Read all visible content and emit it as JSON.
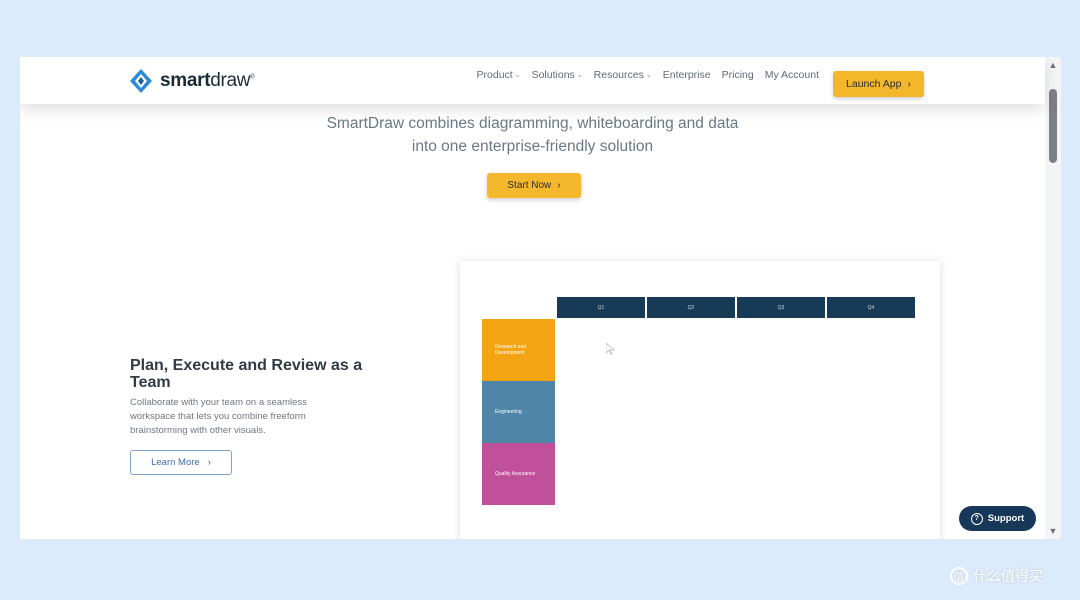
{
  "logo": {
    "name": "smartdraw",
    "part_bold": "smart",
    "part_regular": "draw",
    "mark": "®"
  },
  "nav": {
    "items": [
      {
        "label": "Product",
        "has_dropdown": true
      },
      {
        "label": "Solutions",
        "has_dropdown": true
      },
      {
        "label": "Resources",
        "has_dropdown": true
      },
      {
        "label": "Enterprise",
        "has_dropdown": false
      },
      {
        "label": "Pricing",
        "has_dropdown": false
      },
      {
        "label": "My Account",
        "has_dropdown": false
      }
    ],
    "launch_label": "Launch App"
  },
  "hero": {
    "tagline_line1": "SmartDraw combines diagramming, whiteboarding and data",
    "tagline_line2": "into one enterprise-friendly solution",
    "start_label": "Start Now"
  },
  "feature": {
    "title": "Plan, Execute and Review as a Team",
    "desc": "Collaborate with your team on a seamless workspace that lets you combine freeform brainstorming with other visuals.",
    "learn_label": "Learn More"
  },
  "preview": {
    "quarters": [
      "Q1",
      "Q2",
      "Q3",
      "Q4"
    ],
    "lanes": [
      {
        "label": "Research and Development",
        "color": "#f2a413"
      },
      {
        "label": "Engineering",
        "color": "#4f85a7"
      },
      {
        "label": "Quality Assurance",
        "color": "#c0509a"
      }
    ]
  },
  "support_label": "Support",
  "watermark": {
    "icon_char": "值",
    "text": "什么值得买"
  },
  "colors": {
    "accent": "#f4b62a",
    "navy": "#173b57",
    "support": "#18385a"
  }
}
